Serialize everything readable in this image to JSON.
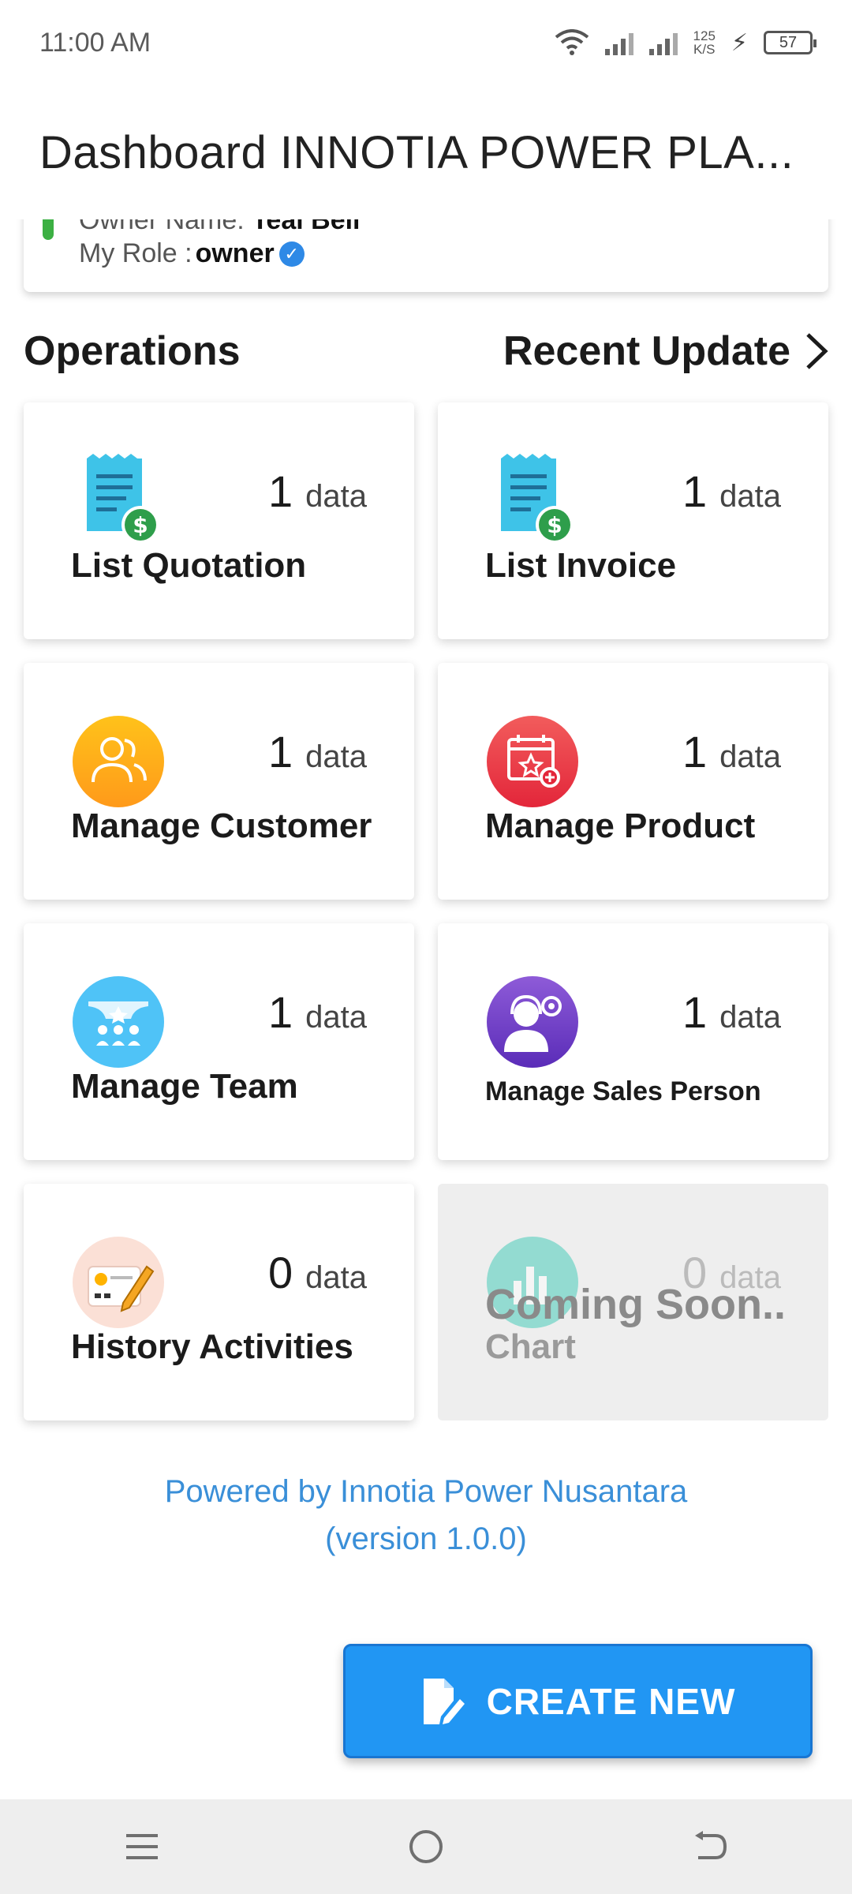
{
  "status": {
    "time": "11:00 AM",
    "speed_top": "125",
    "speed_bottom": "K/S",
    "battery": "57"
  },
  "header": {
    "title": "Dashboard INNOTIA POWER PLA..."
  },
  "owner": {
    "name_label": "Owner Name: ",
    "name_value": "Teal Bell",
    "role_label": "My Role : ",
    "role_value": "owner"
  },
  "sections": {
    "operations": "Operations",
    "recent": "Recent Update"
  },
  "tiles": [
    {
      "label": "List Quotation",
      "count": "1",
      "unit": "data",
      "icon": "quotation-icon"
    },
    {
      "label": "List Invoice",
      "count": "1",
      "unit": "data",
      "icon": "invoice-icon"
    },
    {
      "label": "Manage Customer",
      "count": "1",
      "unit": "data",
      "icon": "customer-icon"
    },
    {
      "label": "Manage Product",
      "count": "1",
      "unit": "data",
      "icon": "product-icon"
    },
    {
      "label": "Manage Team",
      "count": "1",
      "unit": "data",
      "icon": "team-icon"
    },
    {
      "label": "Manage Sales Person",
      "count": "1",
      "unit": "data",
      "icon": "sales-person-icon"
    },
    {
      "label": "History Activities",
      "count": "0",
      "unit": "data",
      "icon": "history-icon"
    },
    {
      "label": "Chart",
      "count": "0",
      "unit": "data",
      "icon": "chart-icon",
      "overlay": "Coming Soon.."
    }
  ],
  "footer": {
    "line1": "Powered by Innotia Power Nusantara",
    "line2": "(version 1.0.0)"
  },
  "fab": {
    "label": "CREATE NEW",
    "icon": "edit-document-icon"
  },
  "nav": {
    "menu": "menu-icon",
    "home": "home-icon",
    "back": "back-icon"
  },
  "colors": {
    "accent": "#2196f3",
    "footer_link": "#3a8fd8",
    "owner_marker": "#3cb043"
  }
}
